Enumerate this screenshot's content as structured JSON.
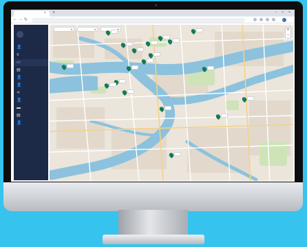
{
  "browser": {
    "tab_title": "",
    "url": "",
    "new_tab_symbol": "+",
    "close_symbol": "×"
  },
  "app": {
    "title": ""
  },
  "sidebar": {
    "items": [
      {
        "icon": "user-icon",
        "glyph": "👤",
        "label": "",
        "active": false
      },
      {
        "icon": "list-icon",
        "glyph": "≡",
        "label": "",
        "active": false
      },
      {
        "icon": "map-icon",
        "glyph": "▭",
        "label": "",
        "active": true
      },
      {
        "icon": "layers-icon",
        "glyph": "▤",
        "label": "",
        "active": false
      },
      {
        "icon": "user-icon",
        "glyph": "👤",
        "label": "",
        "active": false
      },
      {
        "icon": "user-icon",
        "glyph": "👤",
        "label": "",
        "active": false
      },
      {
        "icon": "share-icon",
        "glyph": "⋖",
        "label": "",
        "active": false
      },
      {
        "icon": "user-icon",
        "glyph": "👤",
        "label": "",
        "active": false
      },
      {
        "icon": "chart-icon",
        "glyph": "▬",
        "label": "",
        "active": false
      },
      {
        "icon": "document-icon",
        "glyph": "▤",
        "label": "",
        "active": false
      },
      {
        "icon": "user-icon",
        "glyph": "👤",
        "label": "",
        "active": false
      }
    ]
  },
  "filters": [
    {
      "value": ""
    },
    {
      "value": ""
    },
    {
      "value": ""
    }
  ],
  "map": {
    "markers": [
      {
        "label": ""
      },
      {
        "label": ""
      },
      {
        "label": ""
      },
      {
        "label": ""
      },
      {
        "label": ""
      },
      {
        "label": ""
      },
      {
        "label": ""
      },
      {
        "label": ""
      },
      {
        "label": ""
      },
      {
        "label": ""
      },
      {
        "label": ""
      },
      {
        "label": ""
      },
      {
        "label": ""
      },
      {
        "label": ""
      },
      {
        "label": ""
      },
      {
        "label": ""
      },
      {
        "label": ""
      },
      {
        "label": ""
      },
      {
        "label": ""
      }
    ],
    "zoom_in": "+",
    "zoom_out": "−"
  },
  "colors": {
    "sidebar": "#1d2a47",
    "marker": "#147a56",
    "water": "#8cc2dd",
    "background": "#36c4ee"
  }
}
